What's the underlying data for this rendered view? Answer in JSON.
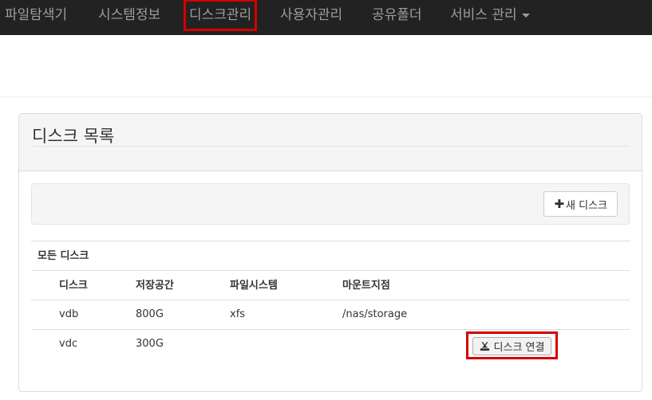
{
  "nav": {
    "items": [
      {
        "label": "파일탐색기"
      },
      {
        "label": "시스템정보"
      },
      {
        "label": "디스크관리"
      },
      {
        "label": "사용자관리"
      },
      {
        "label": "공유폴더"
      },
      {
        "label": "서비스 관리"
      }
    ]
  },
  "panel": {
    "title": "디스크 목록",
    "new_disk_label": "새 디스크"
  },
  "table": {
    "caption": "모든 디스크",
    "headers": [
      "디스크",
      "저장공간",
      "파일시스템",
      "마운트지점"
    ],
    "rows": [
      {
        "disk": "vdb",
        "size": "800G",
        "fs": "xfs",
        "mount": "/nas/storage"
      },
      {
        "disk": "vdc",
        "size": "300G",
        "fs": "",
        "mount": "",
        "action": "디스크 연결"
      }
    ]
  },
  "colors": {
    "navbar_bg": "#222222",
    "nav_text": "#9d9d9d",
    "highlight": "#d40000"
  }
}
